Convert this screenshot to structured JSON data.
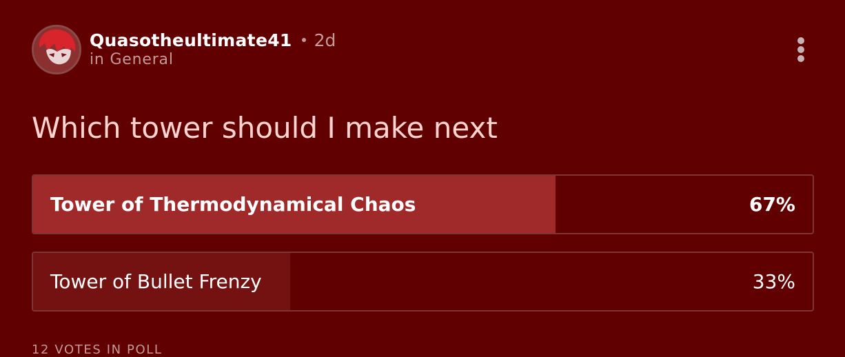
{
  "post": {
    "author": "Quasotheultimate41",
    "time_ago": "2d",
    "category": "in General",
    "title": "Which tower should I make next"
  },
  "poll": {
    "options": [
      {
        "label": "Tower of Thermodynamical Chaos",
        "percent_label": "67%",
        "fraction": 0.67
      },
      {
        "label": "Tower of Bullet Frenzy",
        "percent_label": "33%",
        "fraction": 0.33
      }
    ],
    "votes_text": "12 VOTES IN POLL"
  },
  "icons": {
    "menu": "more-vertical-icon",
    "avatar": "user-avatar"
  },
  "colors": {
    "background": "#600000",
    "leading_fill": "#a0292a",
    "secondary_fill": "#741212",
    "muted_text": "#c69a9a",
    "title_text": "#ffd4d0"
  }
}
